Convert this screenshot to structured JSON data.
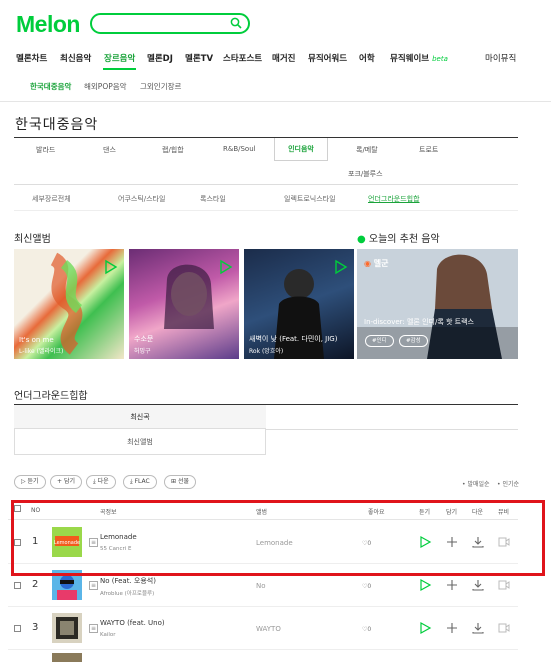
{
  "header": {
    "logo": "Melon",
    "search": {
      "placeholder": ""
    }
  },
  "gnb": [
    {
      "label": "멜론차트",
      "active": false
    },
    {
      "label": "최신음악",
      "active": false
    },
    {
      "label": "장르음악",
      "active": true
    },
    {
      "label": "멜론DJ",
      "active": false
    },
    {
      "label": "멜론TV",
      "active": false
    },
    {
      "label": "스타포스트",
      "active": false
    },
    {
      "label": "매거진",
      "active": false
    },
    {
      "label": "뮤직어워드",
      "active": false
    },
    {
      "label": "어학",
      "active": false
    },
    {
      "label": "뮤직웨이브",
      "active": false
    },
    {
      "label": "마이뮤직",
      "active": false
    }
  ],
  "gnb_beta": "beta",
  "subnav": [
    {
      "label": "한국대중음악",
      "active": true
    },
    {
      "label": "해외POP음악",
      "active": false
    },
    {
      "label": "그외인기장르",
      "active": false
    }
  ],
  "page_title": "한국대중음악",
  "genres": [
    "발라드",
    "댄스",
    "랩/힙합",
    "R&B/Soul",
    "인디음악",
    "록/메탈",
    "트로트",
    "포크/블루스"
  ],
  "genre_selected": "인디음악",
  "subgenres": [
    "세부장르전체",
    "어쿠스틱/스타일",
    "록스타일",
    "일렉트로닉스타일",
    "언더그라운드힙합"
  ],
  "subgenre_selected": "언더그라운드힙합",
  "new_albums": {
    "title": "최신앨범",
    "items": [
      {
        "title": "It's on me",
        "artist": "L-like (엘라이크)"
      },
      {
        "title": "수소문",
        "artist": "허밍구"
      },
      {
        "title": "새벽이 낮 (Feat. 다민이, JIG)",
        "artist": "Rok (앙흐아)"
      }
    ]
  },
  "recommend": {
    "title": "오늘의 추천 음악",
    "channel": "멜군",
    "desc": "In-discover: 멜론 인디/록 핫 트랙스",
    "tags": [
      "#인디",
      "#감성"
    ]
  },
  "section_title": "언더그라운드힙합",
  "cat_tabs": [
    "최신곡",
    "최신앨범"
  ],
  "toolbar": {
    "listen": "듣기",
    "add": "담기",
    "download": "다운",
    "flac": "FLAC",
    "gift": "선물"
  },
  "sort": {
    "popular": "• 발매일순",
    "likes": "• 인기순"
  },
  "table_header": {
    "no": "NO",
    "song": "곡정보",
    "album": "앨범",
    "like": "좋아요",
    "listen": "듣기",
    "add": "담기",
    "download": "다운",
    "mv": "뮤비"
  },
  "rows": [
    {
      "rank": "1",
      "title": "Lemonade",
      "artist": "55 Cancri E",
      "album": "Lemonade",
      "likes": "♡0"
    },
    {
      "rank": "2",
      "title": "No (Feat. 오용석)",
      "artist": "Afroblue (아프로블루)",
      "album": "No",
      "likes": "♡0"
    },
    {
      "rank": "3",
      "title": "WAYTO (feat. Uno)",
      "artist": "Kailor",
      "album": "WAYTO",
      "likes": "♡0"
    }
  ]
}
